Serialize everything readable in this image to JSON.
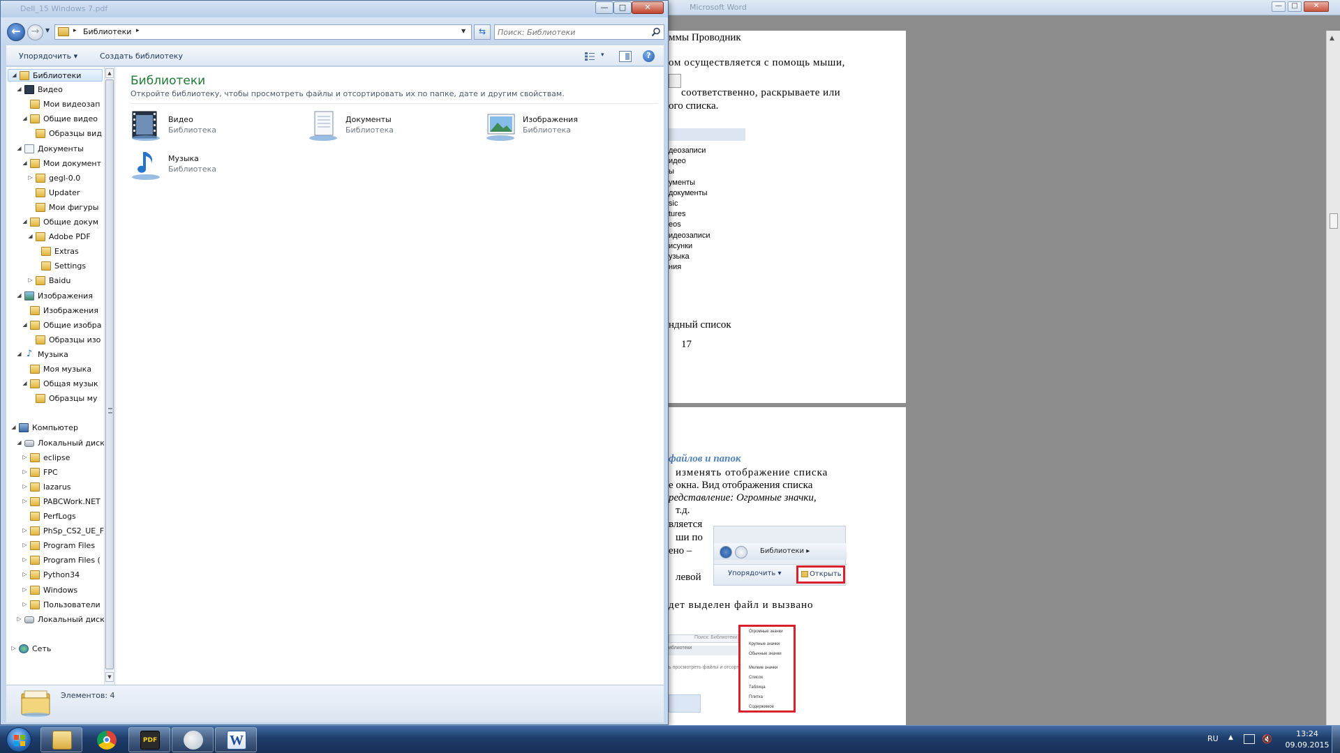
{
  "word": {
    "title": "Microsoft Word",
    "controls": {
      "minimize": "—",
      "maximize": "□",
      "close": "✕"
    },
    "page1": {
      "lines": [
        "ммы Проводник",
        "ом осуществляется с помощь мыши,",
        "соответственно, раскрываете или",
        "ого списка.",
        "ндный список",
        "17"
      ],
      "snapshot_items": [
        "деозаписи",
        "идео",
        "ы",
        "ументы",
        "документы",
        "sic",
        "tures",
        "eos",
        "идеозаписи",
        "исунки",
        "узыка",
        "ния"
      ]
    },
    "page2": {
      "heading": "файлов и папок",
      "lines": [
        "изменять отображение списка",
        "е окна. Вид отображения списка",
        "редставление: Огромные значки,",
        "т.д.",
        "вляется",
        "ши по",
        "ено –",
        "левой",
        "дет выделен файл и вызвано"
      ],
      "mini_shot": {
        "crumb": "Библиотеки ▸",
        "sort": "Упорядочить ▾",
        "open": "Открыть"
      },
      "mini_search": "Поиск: Библиотеки",
      "mini_left": "иблиотеки",
      "mini_desc": "ь просмотреть файлы и отсортиров",
      "mini_menu": [
        "Огромные значки",
        "Крупные значки",
        "Обычные значки",
        "Мелкие значки",
        "Список",
        "Таблица",
        "Плитка",
        "Содержимое"
      ]
    }
  },
  "explorer": {
    "title": "Dell_15 Windows 7.pdf",
    "controls": {
      "minimize": "—",
      "maximize": "□",
      "close": "✕"
    },
    "address": {
      "crumb": "Библиотеки",
      "sep": "▸"
    },
    "search": {
      "placeholder": "Поиск: Библиотеки"
    },
    "toolbar": {
      "organize": "Упорядочить ▾",
      "new_library": "Создать библиотеку",
      "views": "▾",
      "help": "?"
    },
    "tree": [
      {
        "label": "Библиотеки",
        "icon": "lib",
        "twist": "◢",
        "selected": true
      },
      {
        "label": "Видео",
        "icon": "video",
        "twist": "◢"
      },
      {
        "label": "Мои видеозап",
        "icon": "folder",
        "twist": ""
      },
      {
        "label": "Общие видео",
        "icon": "folder",
        "twist": "◢"
      },
      {
        "label": "Образцы вид",
        "icon": "folder",
        "twist": ""
      },
      {
        "label": "Документы",
        "icon": "doc",
        "twist": "◢"
      },
      {
        "label": "Мои документ",
        "icon": "folder",
        "twist": "◢"
      },
      {
        "label": "gegl-0.0",
        "icon": "folder",
        "twist": "▷"
      },
      {
        "label": "Updater",
        "icon": "folder",
        "twist": ""
      },
      {
        "label": "Мои фигуры",
        "icon": "folder",
        "twist": ""
      },
      {
        "label": "Общие докум",
        "icon": "folder",
        "twist": "◢"
      },
      {
        "label": "Adobe PDF",
        "icon": "folder",
        "twist": "◢"
      },
      {
        "label": "Extras",
        "icon": "folder",
        "twist": ""
      },
      {
        "label": "Settings",
        "icon": "folder",
        "twist": ""
      },
      {
        "label": "Baidu",
        "icon": "folder",
        "twist": "▷"
      },
      {
        "label": "Изображения",
        "icon": "img",
        "twist": "◢"
      },
      {
        "label": "Изображения",
        "icon": "folder",
        "twist": ""
      },
      {
        "label": "Общие изобра",
        "icon": "folder",
        "twist": "◢"
      },
      {
        "label": "Образцы изо",
        "icon": "folder",
        "twist": ""
      },
      {
        "label": "Музыка",
        "icon": "music",
        "twist": "◢"
      },
      {
        "label": "Моя музыка",
        "icon": "folder",
        "twist": ""
      },
      {
        "label": "Общая музык",
        "icon": "folder",
        "twist": "◢"
      },
      {
        "label": "Образцы му",
        "icon": "folder",
        "twist": ""
      },
      {
        "label": "",
        "icon": "none",
        "twist": ""
      },
      {
        "label": "Компьютер",
        "icon": "pc",
        "twist": "◢"
      },
      {
        "label": "Локальный диск",
        "icon": "drive",
        "twist": "◢"
      },
      {
        "label": "eclipse",
        "icon": "folder",
        "twist": "▷"
      },
      {
        "label": "FPC",
        "icon": "folder",
        "twist": "▷"
      },
      {
        "label": "lazarus",
        "icon": "folder",
        "twist": "▷"
      },
      {
        "label": "PABCWork.NET",
        "icon": "folder",
        "twist": "▷"
      },
      {
        "label": "PerfLogs",
        "icon": "folder",
        "twist": ""
      },
      {
        "label": "PhSp_CS2_UE_F",
        "icon": "folder",
        "twist": "▷"
      },
      {
        "label": "Program Files",
        "icon": "folder",
        "twist": "▷"
      },
      {
        "label": "Program Files (",
        "icon": "folder",
        "twist": "▷"
      },
      {
        "label": "Python34",
        "icon": "folder",
        "twist": "▷"
      },
      {
        "label": "Windows",
        "icon": "folder",
        "twist": "▷"
      },
      {
        "label": "Пользователи",
        "icon": "folder",
        "twist": "▷"
      },
      {
        "label": "Локальный диск",
        "icon": "drive",
        "twist": "▷"
      },
      {
        "label": "",
        "icon": "none",
        "twist": ""
      },
      {
        "label": "Сеть",
        "icon": "net",
        "twist": "▷"
      }
    ],
    "content": {
      "title": "Библиотеки",
      "description": "Откройте библиотеку, чтобы просмотреть файлы и отсортировать их по папке, дате и другим свойствам.",
      "libraries": [
        {
          "name": "Видео",
          "sub": "Библиотека"
        },
        {
          "name": "Документы",
          "sub": "Библиотека"
        },
        {
          "name": "Изображения",
          "sub": "Библиотека"
        },
        {
          "name": "Музыка",
          "sub": "Библиотека"
        }
      ]
    },
    "status": {
      "text": "Элементов: 4"
    }
  },
  "taskbar": {
    "apps": [
      "Проводник",
      "Google Chrome",
      "PDF",
      "Paint",
      "Microsoft Word"
    ],
    "pdf_label": "PDF",
    "word_label": "W",
    "tray": {
      "lang": "RU",
      "arrow": "▲",
      "volume": "🔇",
      "time": "13:24",
      "date": "09.09.2015"
    }
  }
}
